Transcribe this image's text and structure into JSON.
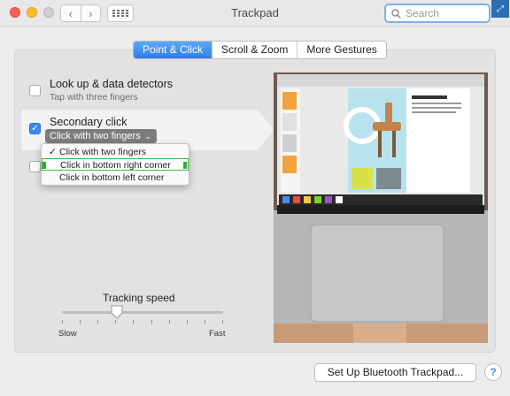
{
  "window": {
    "title": "Trackpad"
  },
  "toolbar": {
    "back_icon": "chevron-left-icon",
    "forward_icon": "chevron-right-icon",
    "show_all_icon": "grid-icon",
    "search_placeholder": "Search"
  },
  "tabs": [
    {
      "label": "Point & Click",
      "active": true
    },
    {
      "label": "Scroll & Zoom",
      "active": false
    },
    {
      "label": "More Gestures",
      "active": false
    }
  ],
  "options": {
    "lookup": {
      "label": "Look up & data detectors",
      "sub": "Tap with three fingers",
      "checked": false
    },
    "secondary": {
      "label": "Secondary click",
      "checked": true,
      "selected_value": "Click with two fingers"
    }
  },
  "menu": {
    "items": [
      {
        "label": "Click with two fingers",
        "checked": true
      },
      {
        "label": "Click in bottom right corner",
        "checked": false,
        "highlighted": true
      },
      {
        "label": "Click in bottom left corner",
        "checked": false
      }
    ]
  },
  "tracking": {
    "title": "Tracking speed",
    "slow": "Slow",
    "fast": "Fast",
    "value": 0.34
  },
  "buttons": {
    "setup": "Set Up Bluetooth Trackpad...",
    "help": "?"
  },
  "colors": {
    "accent": "#3b88f5",
    "highlight_border": "#3fbf3f"
  }
}
